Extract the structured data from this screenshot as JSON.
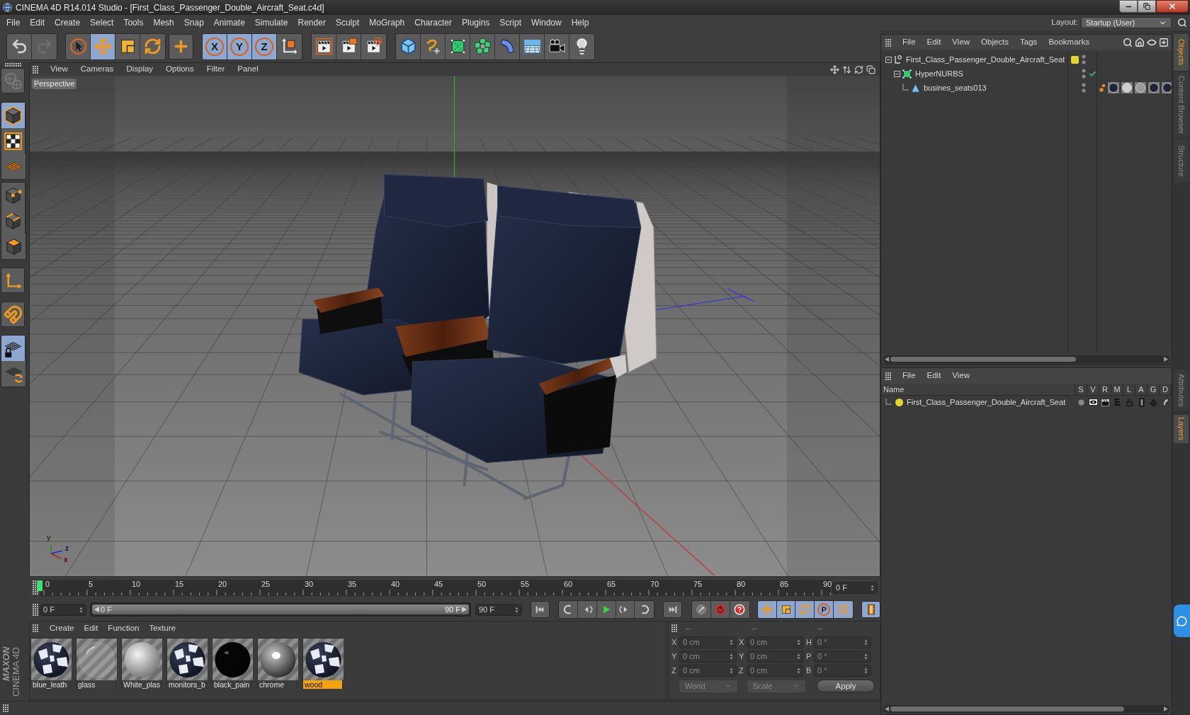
{
  "window": {
    "title": "CINEMA 4D R14.014 Studio - [First_Class_Passenger_Double_Aircraft_Seat.c4d]"
  },
  "menu": [
    "File",
    "Edit",
    "Create",
    "Select",
    "Tools",
    "Mesh",
    "Snap",
    "Animate",
    "Simulate",
    "Render",
    "Sculpt",
    "MoGraph",
    "Character",
    "Plugins",
    "Script",
    "Window",
    "Help"
  ],
  "layout": {
    "label": "Layout:",
    "value": "Startup (User)"
  },
  "toolbar": [
    {
      "items": [
        {
          "kind": "undo",
          "disabled": false
        },
        {
          "kind": "redo",
          "disabled": true
        }
      ]
    },
    {
      "items": [
        {
          "kind": "select",
          "selected": false
        },
        {
          "kind": "move",
          "selected": true
        },
        {
          "kind": "scale",
          "selected": false
        },
        {
          "kind": "rotate",
          "selected": false
        }
      ]
    },
    {
      "items": [
        {
          "kind": "recent",
          "selected": false
        }
      ]
    },
    {
      "items": [
        {
          "kind": "axis",
          "label": "X",
          "selected": true
        },
        {
          "kind": "axis",
          "label": "Y",
          "selected": true
        },
        {
          "kind": "axis",
          "label": "Z",
          "selected": true
        },
        {
          "kind": "coords",
          "selected": false
        }
      ]
    },
    {
      "items": [
        {
          "kind": "render_view"
        },
        {
          "kind": "render_picture"
        },
        {
          "kind": "render_settings"
        }
      ]
    },
    {
      "items": [
        {
          "kind": "cube"
        },
        {
          "kind": "spline"
        },
        {
          "kind": "nurbs"
        },
        {
          "kind": "cloner"
        },
        {
          "kind": "deformer"
        },
        {
          "kind": "floor"
        },
        {
          "kind": "camera"
        },
        {
          "kind": "light"
        }
      ]
    }
  ],
  "tools_palette": [
    {
      "items": [
        {
          "kind": "make_editable",
          "disabled": true
        }
      ]
    },
    {
      "items": [
        {
          "kind": "model",
          "selected": true
        },
        {
          "kind": "texture",
          "selected": false
        },
        {
          "kind": "workplane",
          "selected": false
        }
      ]
    },
    {
      "items": [
        {
          "kind": "points",
          "selected": false
        },
        {
          "kind": "edges",
          "selected": false
        },
        {
          "kind": "polygons",
          "selected": false
        }
      ]
    },
    {
      "items": [
        {
          "kind": "axis_mode",
          "selected": false
        }
      ]
    },
    {
      "items": [
        {
          "kind": "snap",
          "selected": false
        }
      ]
    },
    {
      "items": [
        {
          "kind": "workplane_lock",
          "selected": true
        },
        {
          "kind": "workplane_sync",
          "selected": false
        }
      ]
    }
  ],
  "logo": {
    "brand": "MAXON",
    "product": "CINEMA 4D"
  },
  "viewport": {
    "menu": [
      "View",
      "Cameras",
      "Display",
      "Options",
      "Filter",
      "Panel"
    ],
    "camera": "Perspective",
    "gizmo_labels": [
      "y",
      "z",
      "x"
    ]
  },
  "timeline": {
    "ticks": [
      "0",
      "5",
      "10",
      "15",
      "20",
      "25",
      "30",
      "35",
      "40",
      "45",
      "50",
      "55",
      "60",
      "65",
      "70",
      "75",
      "80",
      "85",
      "90"
    ],
    "current_frame": "0 F"
  },
  "playback": {
    "start_field": "0 F",
    "range": {
      "start": "0 F",
      "end": "90 F",
      "level": 1
    },
    "end_field": "90 F",
    "groups": [
      {
        "items": [
          {
            "kind": "first"
          }
        ]
      },
      {
        "items": [
          {
            "kind": "prev_key"
          },
          {
            "kind": "prev_frame"
          },
          {
            "kind": "play"
          },
          {
            "kind": "next_frame"
          },
          {
            "kind": "next_key"
          }
        ]
      },
      {
        "items": [
          {
            "kind": "last"
          }
        ]
      },
      {
        "items": [
          {
            "kind": "autokey",
            "disabled": true
          },
          {
            "kind": "record"
          },
          {
            "kind": "help"
          }
        ]
      },
      {
        "items": [
          {
            "kind": "key_move",
            "selected": true
          },
          {
            "kind": "key_scale",
            "selected": true
          },
          {
            "kind": "key_rotate",
            "selected": true
          },
          {
            "kind": "key_param",
            "label": "P",
            "selected": true
          },
          {
            "kind": "key_points",
            "selected": true
          }
        ]
      },
      {
        "items": [
          {
            "kind": "timeline",
            "selected": true
          }
        ]
      }
    ]
  },
  "materials": {
    "menu": [
      "Create",
      "Edit",
      "Function",
      "Texture"
    ],
    "items": [
      {
        "name": "blue_leath",
        "kind": "leather",
        "selected": false
      },
      {
        "name": "glass",
        "kind": "glass",
        "selected": false
      },
      {
        "name": "White_plas",
        "kind": "plastic",
        "selected": false
      },
      {
        "name": "monitors_b",
        "kind": "leather",
        "selected": false
      },
      {
        "name": "black_pain",
        "kind": "black",
        "selected": false
      },
      {
        "name": "chrome",
        "kind": "chrome",
        "selected": false
      },
      {
        "name": "wood",
        "kind": "leather",
        "selected": true
      }
    ]
  },
  "coordinates": {
    "headers": [
      "--",
      "--",
      "--"
    ],
    "rows": [
      {
        "cells": [
          {
            "axis": "X",
            "value": "0 cm"
          },
          {
            "axis": "X",
            "value": "0 cm"
          },
          {
            "axis": "H",
            "value": "0 °"
          }
        ]
      },
      {
        "cells": [
          {
            "axis": "Y",
            "value": "0 cm"
          },
          {
            "axis": "Y",
            "value": "0 cm"
          },
          {
            "axis": "P",
            "value": "0 °"
          }
        ]
      },
      {
        "cells": [
          {
            "axis": "Z",
            "value": "0 cm"
          },
          {
            "axis": "Z",
            "value": "0 cm"
          },
          {
            "axis": "B",
            "value": "0 °"
          }
        ]
      }
    ],
    "space": "World",
    "mode": "Scale",
    "apply": "Apply"
  },
  "object_manager": {
    "menu": [
      "File",
      "Edit",
      "View",
      "Objects",
      "Tags",
      "Bookmarks"
    ],
    "objects": [
      {
        "name": "First_Class_Passenger_Double_Aircraft_Seat",
        "kind": "null",
        "color": "#e2d62c",
        "expanded": true,
        "children": [
          {
            "name": "HyperNURBS",
            "kind": "generator",
            "enabled": true,
            "expanded": true,
            "children": [
              {
                "name": "busines_seats013",
                "kind": "polygon"
              }
            ]
          }
        ]
      }
    ]
  },
  "layer_manager": {
    "menu": [
      "File",
      "Edit",
      "View"
    ],
    "columns": [
      "Name",
      "S",
      "V",
      "R",
      "M",
      "L",
      "A",
      "G",
      "D"
    ],
    "layers": [
      {
        "name": "First_Class_Passenger_Double_Aircraft_Seat",
        "color": "#e2d62c"
      }
    ]
  },
  "side_tabs": {
    "top": [
      {
        "label": "Objects",
        "selected": true
      },
      {
        "label": "Content Browser",
        "selected": false
      },
      {
        "label": "Structure",
        "selected": false
      }
    ],
    "bottom": [
      {
        "label": "Attributes",
        "selected": false
      },
      {
        "label": "Layers",
        "selected": true
      }
    ]
  }
}
